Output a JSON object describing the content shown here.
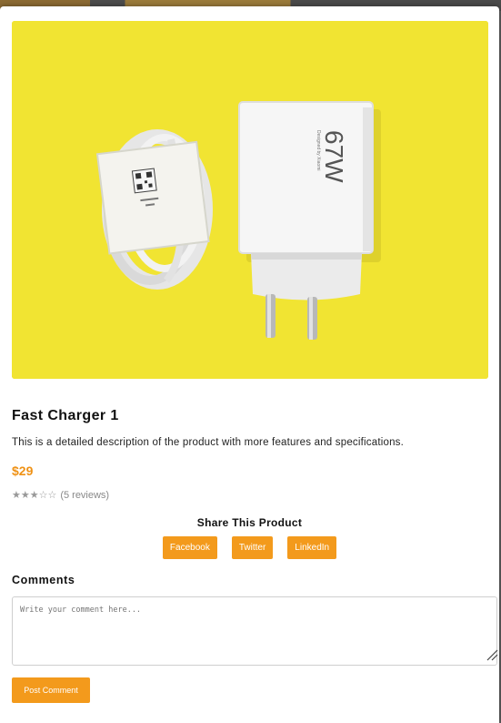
{
  "modal": {
    "close_icon": "close-icon",
    "image_alt": "product-photo",
    "product": {
      "title": "Fast Charger 1",
      "description": "This is a detailed description of the product with more features and specifications.",
      "price": "$29",
      "rating_stars": "★★★☆☆",
      "rating_reviews": "(5 reviews)",
      "image_text": {
        "wattage": "67W",
        "brand_line": "Designed by Xiaomi"
      }
    },
    "share": {
      "title": "Share This Product",
      "buttons": [
        "Facebook",
        "Twitter",
        "LinkedIn"
      ]
    },
    "comments": {
      "title": "Comments",
      "placeholder": "Write your comment here...",
      "post_label": "Post Comment"
    }
  },
  "colors": {
    "accent": "#f39a1c",
    "price": "#ef9216",
    "image_background": "#f1e432"
  }
}
